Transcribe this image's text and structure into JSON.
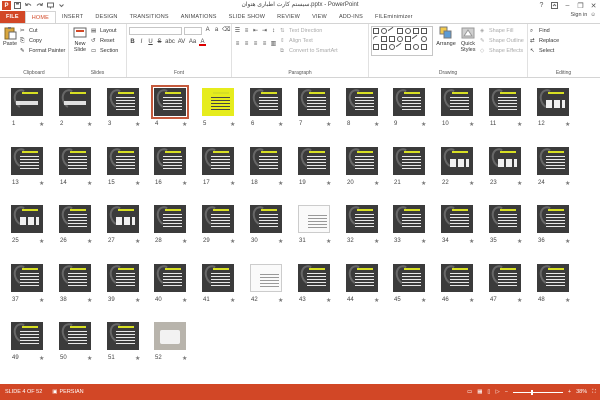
{
  "app": {
    "title": "سیستم کارت اطباری هتوان.pptx - PowerPoint",
    "brand_color": "#d24726"
  },
  "qat": {
    "logo": "P"
  },
  "window": {
    "help": "?",
    "minimize": "–",
    "restore": "❐",
    "close": "✕"
  },
  "tabs": [
    "FILE",
    "HOME",
    "INSERT",
    "DESIGN",
    "TRANSITIONS",
    "ANIMATIONS",
    "SLIDE SHOW",
    "REVIEW",
    "VIEW",
    "ADD-INS",
    "FILEminimizer"
  ],
  "active_tab": "HOME",
  "account": {
    "signin": "Sign in"
  },
  "ribbon": {
    "clipboard": {
      "paste": "Paste",
      "cut": "Cut",
      "copy": "Copy",
      "format_painter": "Format Painter",
      "label": "Clipboard"
    },
    "slides": {
      "new_slide_1": "New",
      "new_slide_2": "Slide",
      "layout": "Layout",
      "reset": "Reset",
      "section": "Section",
      "label": "Slides"
    },
    "font": {
      "bold": "B",
      "italic": "I",
      "underline": "U",
      "strike": "S",
      "shadow": "abc",
      "spacing": "AV",
      "case": "Aa",
      "color": "A",
      "label": "Font"
    },
    "paragraph": {
      "text_direction": "Text Direction",
      "align_text": "Align Text",
      "convert_smartart": "Convert to SmartArt",
      "label": "Paragraph"
    },
    "drawing": {
      "arrange": "Arrange",
      "quick_styles_1": "Quick",
      "quick_styles_2": "Styles",
      "shape_fill": "Shape Fill",
      "shape_outline": "Shape Outline",
      "shape_effects": "Shape Effects",
      "label": "Drawing"
    },
    "editing": {
      "find": "Find",
      "replace": "Replace",
      "select": "Select",
      "label": "Editing"
    }
  },
  "slides": [
    {
      "num": "1",
      "kind": "title"
    },
    {
      "num": "2",
      "kind": "title2"
    },
    {
      "num": "3",
      "kind": "text"
    },
    {
      "num": "4",
      "kind": "text",
      "selected": true
    },
    {
      "num": "5",
      "kind": "yellow"
    },
    {
      "num": "6",
      "kind": "text"
    },
    {
      "num": "7",
      "kind": "text"
    },
    {
      "num": "8",
      "kind": "text"
    },
    {
      "num": "9",
      "kind": "text"
    },
    {
      "num": "10",
      "kind": "text"
    },
    {
      "num": "11",
      "kind": "text"
    },
    {
      "num": "12",
      "kind": "diagram"
    },
    {
      "num": "13",
      "kind": "text"
    },
    {
      "num": "14",
      "kind": "text"
    },
    {
      "num": "15",
      "kind": "text"
    },
    {
      "num": "16",
      "kind": "text"
    },
    {
      "num": "17",
      "kind": "text"
    },
    {
      "num": "18",
      "kind": "text"
    },
    {
      "num": "19",
      "kind": "text"
    },
    {
      "num": "20",
      "kind": "text"
    },
    {
      "num": "21",
      "kind": "text"
    },
    {
      "num": "22",
      "kind": "diagram"
    },
    {
      "num": "23",
      "kind": "diagram"
    },
    {
      "num": "24",
      "kind": "text"
    },
    {
      "num": "25",
      "kind": "diagram"
    },
    {
      "num": "26",
      "kind": "text"
    },
    {
      "num": "27",
      "kind": "diagram"
    },
    {
      "num": "28",
      "kind": "text"
    },
    {
      "num": "29",
      "kind": "text"
    },
    {
      "num": "30",
      "kind": "text"
    },
    {
      "num": "31",
      "kind": "white"
    },
    {
      "num": "32",
      "kind": "text"
    },
    {
      "num": "33",
      "kind": "text"
    },
    {
      "num": "34",
      "kind": "text"
    },
    {
      "num": "35",
      "kind": "text"
    },
    {
      "num": "36",
      "kind": "text"
    },
    {
      "num": "37",
      "kind": "text"
    },
    {
      "num": "38",
      "kind": "text"
    },
    {
      "num": "39",
      "kind": "text"
    },
    {
      "num": "40",
      "kind": "text"
    },
    {
      "num": "41",
      "kind": "text"
    },
    {
      "num": "42",
      "kind": "white"
    },
    {
      "num": "43",
      "kind": "text"
    },
    {
      "num": "44",
      "kind": "text"
    },
    {
      "num": "45",
      "kind": "text"
    },
    {
      "num": "46",
      "kind": "text"
    },
    {
      "num": "47",
      "kind": "text"
    },
    {
      "num": "48",
      "kind": "text"
    },
    {
      "num": "49",
      "kind": "text"
    },
    {
      "num": "50",
      "kind": "text"
    },
    {
      "num": "51",
      "kind": "text"
    },
    {
      "num": "52",
      "kind": "photo"
    }
  ],
  "star": "★",
  "status": {
    "slide_info": "SLIDE 4 OF 52",
    "language": "PERSIAN",
    "zoom": "38%",
    "zoom_fraction": 0.38
  }
}
